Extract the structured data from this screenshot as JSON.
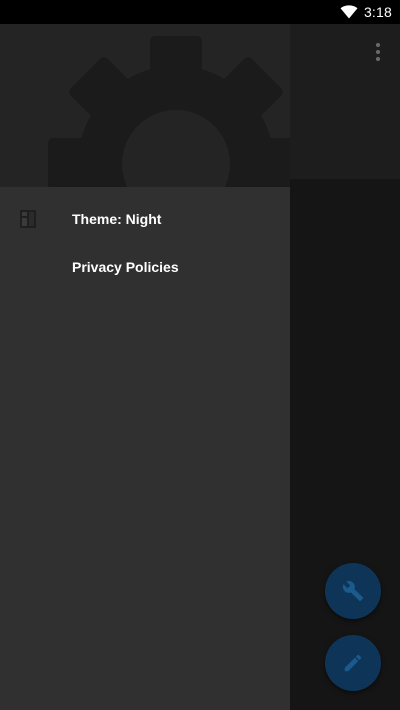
{
  "status_bar": {
    "time": "3:18"
  },
  "drawer": {
    "items": [
      {
        "label": "Theme: Night",
        "icon": "theme-icon"
      },
      {
        "label": "Privacy Policies",
        "icon": ""
      }
    ]
  },
  "fabs": [
    {
      "icon": "wrench-icon"
    },
    {
      "icon": "pencil-icon"
    }
  ],
  "colors": {
    "status_bar": "#000000",
    "drawer_bg": "#303030",
    "drawer_header_bg": "#242424",
    "fab": "#0e3558"
  }
}
